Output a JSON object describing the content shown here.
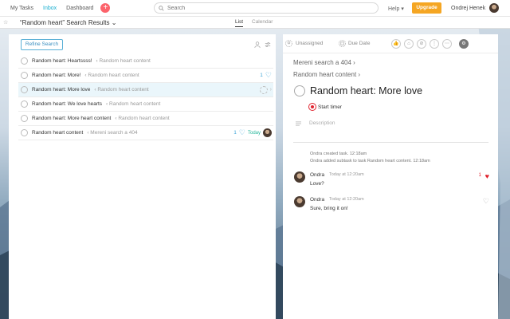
{
  "topbar": {
    "nav": [
      "My Tasks",
      "Inbox",
      "Dashboard"
    ],
    "add_symbol": "+",
    "search_placeholder": "Search",
    "help_label": "Help ▾",
    "upgrade_label": "Upgrade",
    "user_name": "Ondrej Henek"
  },
  "subheader": {
    "star_icon": "☆",
    "title": "“Random heart” Search Results ⌄",
    "tabs": [
      "List",
      "Calendar"
    ]
  },
  "left_pane": {
    "refine_label": "Refine Search",
    "tasks": [
      {
        "name": "Random heart: Heartssss!",
        "project": "‹ Random heart content",
        "likes": "",
        "due": ""
      },
      {
        "name": "Random heart: More!",
        "project": "‹ Random heart content",
        "likes": "1",
        "due": ""
      },
      {
        "name": "Random heart: More love",
        "project": "‹ Random heart content",
        "likes": "",
        "due": ""
      },
      {
        "name": "Random heart: We love hearts",
        "project": "‹ Random heart content",
        "likes": "",
        "due": ""
      },
      {
        "name": "Random heart: More heart content",
        "project": "‹ Random heart content",
        "likes": "",
        "due": ""
      },
      {
        "name": "Random heart content",
        "project": "‹ Mereni search a 404",
        "likes": "1",
        "due": "Today"
      }
    ]
  },
  "right_pane": {
    "assignee": "Unassigned",
    "due_date": "Due Date",
    "breadcrumbs": [
      "Mereni search a 404 ›",
      "Random heart content ›"
    ],
    "task_title": "Random heart: More love",
    "timer_label": "Start timer",
    "description_placeholder": "Description",
    "activity": [
      "Ondra created task.   12:18am",
      "Ondra added subtask to task Random heart content.   12:18am"
    ],
    "comments": [
      {
        "author": "Ondra",
        "time": "Today at 12:20am",
        "text": "Love?",
        "likes": "1",
        "liked": true
      },
      {
        "author": "Ondra",
        "time": "Today at 12:20am",
        "text": "Sure, bring it on!",
        "likes": "",
        "liked": false
      }
    ]
  },
  "colors": {
    "accent": "#1aafd0",
    "upgrade": "#f5a623",
    "heart_red": "#e0232e",
    "like_blue": "#3ba4d6",
    "today_green": "#24b59a"
  }
}
